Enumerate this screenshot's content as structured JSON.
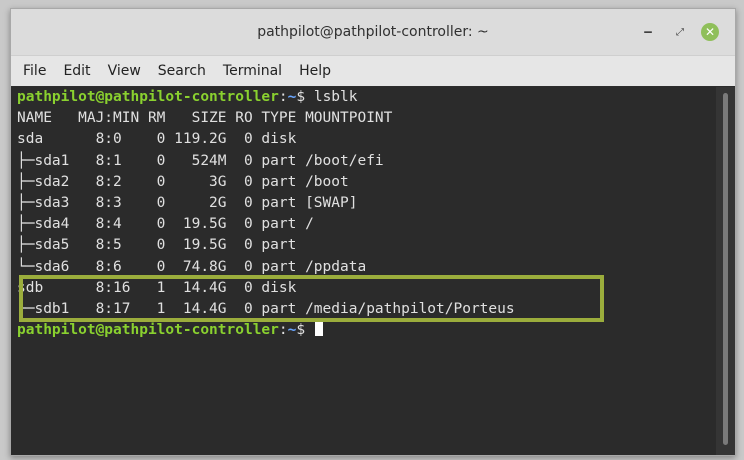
{
  "window": {
    "title": "pathpilot@pathpilot-controller: ~",
    "minimize_glyph": "‒",
    "maximize_glyph": "⤢",
    "close_glyph": "✕"
  },
  "menu": {
    "items": [
      "File",
      "Edit",
      "View",
      "Search",
      "Terminal",
      "Help"
    ]
  },
  "terminal": {
    "prompt_user": "pathpilot@pathpilot-controller",
    "prompt_path": "~",
    "prompt_suffix": "$ ",
    "command": "lsblk",
    "output_lines": [
      "NAME   MAJ:MIN RM   SIZE RO TYPE MOUNTPOINT",
      "sda      8:0    0 119.2G  0 disk ",
      "├─sda1   8:1    0   524M  0 part /boot/efi",
      "├─sda2   8:2    0     3G  0 part /boot",
      "├─sda3   8:3    0     2G  0 part [SWAP]",
      "├─sda4   8:4    0  19.5G  0 part /",
      "├─sda5   8:5    0  19.5G  0 part ",
      "└─sda6   8:6    0  74.8G  0 part /ppdata",
      "sdb      8:16   1  14.4G  0 disk ",
      "└─sdb1   8:17   1  14.4G  0 part /media/pathpilot/Porteus"
    ],
    "highlight_color": "#9bad3c"
  }
}
